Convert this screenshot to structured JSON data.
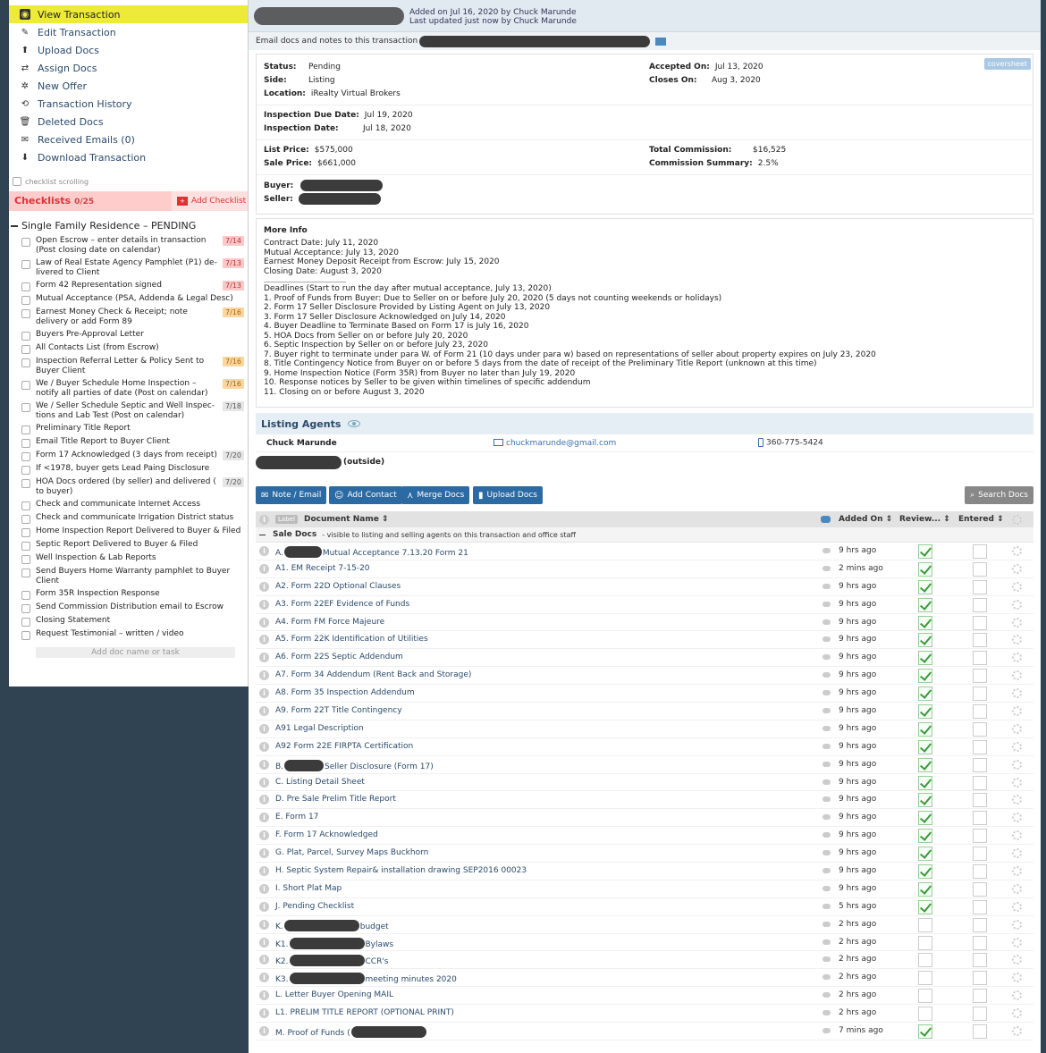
{
  "nav": [
    {
      "label": "View Transaction",
      "icon": "eye-icon",
      "glyph": "◉",
      "active": true
    },
    {
      "label": "Edit Transaction",
      "icon": "edit-icon",
      "glyph": "✎"
    },
    {
      "label": "Upload Docs",
      "icon": "upload-icon",
      "glyph": "⬆"
    },
    {
      "label": "Assign Docs",
      "icon": "assign-icon",
      "glyph": "⇄"
    },
    {
      "label": "New Offer",
      "icon": "gear-icon",
      "glyph": "✲"
    },
    {
      "label": "Transaction History",
      "icon": "history-icon",
      "glyph": "⟲"
    },
    {
      "label": "Deleted Docs",
      "icon": "trash-icon",
      "glyph": "🗑"
    },
    {
      "label": "Received Emails (0)",
      "icon": "mail-icon",
      "glyph": "✉"
    },
    {
      "label": "Download Transaction",
      "icon": "download-icon",
      "glyph": "⬇"
    }
  ],
  "checklist_scrolling": "checklist scrolling",
  "checklists": {
    "title": "Checklists",
    "count": "0/25",
    "add_label": "Add Checklist",
    "add_glyph": "+"
  },
  "checklist_group": "Single Family Residence – PENDING",
  "tasks": [
    {
      "text": "Open Escrow – enter details in transaction (Post closing date on calendar)",
      "due": "7/14",
      "c": "red"
    },
    {
      "text": "Law of Real Estate Agency Pamphlet (P1) de-livered to Client",
      "due": "7/13",
      "c": "red"
    },
    {
      "text": "Form 42 Representation signed",
      "due": "7/13",
      "c": "red"
    },
    {
      "text": "Mutual Acceptance (PSA, Addenda & Legal Desc)",
      "due": "",
      "c": ""
    },
    {
      "text": "Earnest Money Check & Receipt; note delivery or add Form 89",
      "due": "7/16",
      "c": "orange"
    },
    {
      "text": "Buyers Pre-Approval Letter",
      "due": "",
      "c": ""
    },
    {
      "text": "All Contacts List (from Escrow)",
      "due": "",
      "c": ""
    },
    {
      "text": "Inspection Referral Letter & Policy Sent to Buyer Client",
      "due": "7/16",
      "c": "orange"
    },
    {
      "text": "We / Buyer Schedule Home Inspection – notify all parties of date (Post on calendar)",
      "due": "7/16",
      "c": "orange"
    },
    {
      "text": "We / Seller Schedule Septic and Well Inspec-tions and Lab Test (Post on calendar)",
      "due": "7/18",
      "c": "gray"
    },
    {
      "text": "Preliminary Title Report",
      "due": "",
      "c": ""
    },
    {
      "text": "Email Title Report to Buyer Client",
      "due": "",
      "c": ""
    },
    {
      "text": "Form 17 Acknowledged (3 days from receipt)",
      "due": "7/20",
      "c": "gray"
    },
    {
      "text": "If <1978, buyer gets Lead Paing Disclosure",
      "due": "",
      "c": ""
    },
    {
      "text": "HOA Docs ordered (by seller) and delivered ( to buyer)",
      "due": "7/20",
      "c": "gray"
    },
    {
      "text": "Check and communicate Internet Access",
      "due": "",
      "c": ""
    },
    {
      "text": "Check and communicate Irrigation District status",
      "due": "",
      "c": ""
    },
    {
      "text": "Home Inspection Report Delivered to Buyer & Filed",
      "due": "",
      "c": ""
    },
    {
      "text": "Septic Report Delivered to Buyer & Filed",
      "due": "",
      "c": ""
    },
    {
      "text": "Well Inspection & Lab Reports",
      "due": "",
      "c": ""
    },
    {
      "text": "Send Buyers Home Warranty pamphlet to Buyer Client",
      "due": "",
      "c": ""
    },
    {
      "text": "Form 35R Inspection Response",
      "due": "",
      "c": ""
    },
    {
      "text": "Send Commission Distribution email to Escrow",
      "due": "",
      "c": ""
    },
    {
      "text": "Closing Statement",
      "due": "",
      "c": ""
    },
    {
      "text": "Request Testimonial – written / video",
      "due": "",
      "c": ""
    }
  ],
  "add_task_placeholder": "Add doc name or task",
  "header": {
    "added": "Added on Jul 16, 2020 by Chuck Marunde",
    "updated": "Last updated just now by Chuck Marunde"
  },
  "email_docs_label": "Email docs and notes to this transaction",
  "coversheet": "coversheet",
  "details": {
    "status_label": "Status:",
    "status": "Pending",
    "side_label": "Side:",
    "side": "Listing",
    "location_label": "Location:",
    "location": "iRealty Virtual Brokers",
    "accepted_label": "Accepted On:",
    "accepted": "Jul 13, 2020",
    "closes_label": "Closes On:",
    "closes": "Aug 3, 2020",
    "insp_due_label": "Inspection Due Date:",
    "insp_due": "Jul 19, 2020",
    "insp_date_label": "Inspection Date:",
    "insp_date": "Jul 18, 2020",
    "list_price_label": "List Price:",
    "list_price": "$575,000",
    "sale_price_label": "Sale Price:",
    "sale_price": "$661,000",
    "total_comm_label": "Total Commission:",
    "total_comm": "$16,525",
    "comm_summary_label": "Commission Summary:",
    "comm_summary": "2.5%",
    "buyer_label": "Buyer:",
    "seller_label": "Seller:"
  },
  "more_info": {
    "title": "More Info",
    "lines": [
      "Contract Date: July 11, 2020",
      "Mutual Acceptance: July 13, 2020",
      "Earnest Money Deposit Receipt from Escrow: July 15, 2020",
      "Closing Date: August 3, 2020"
    ],
    "deadlines": [
      "Deadlines (Start to run the day after mutual acceptance, July 13, 2020)",
      "1. Proof of Funds from Buyer: Due to Seller on or before July 20, 2020 (5 days not counting weekends or holidays)",
      "2. Form 17 Seller Disclosure Provided by Listing Agent on July 13, 2020",
      "3. Form 17 Seller Disclosure Acknowledged on July 14, 2020",
      "4. Buyer Deadline to Terminate Based on Form 17 is July 16, 2020",
      "5. HOA Docs from Seller on or before July 20, 2020",
      "6. Septic Inspection by Seller on or before July 23, 2020",
      "7. Buyer right to terminate under para W. of Form 21 (10 days under para w) based on representations of seller about property expires on July 23, 2020",
      "8. Title Contingency Notice from Buyer on or before 5 days from the date of receipt of the Preliminary Title Report (unknown at this time)",
      "9. Home Inspection Notice (Form 35R) from Buyer no later than July 19, 2020",
      "10. Response notices by Seller to be given within timelines of specific addendum",
      "11. Closing on or before August 3, 2020"
    ]
  },
  "listing_agents": {
    "title": "Listing Agents",
    "name": "Chuck Marunde",
    "email": "chuckmarunde@gmail.com",
    "phone": "360-775-5424",
    "outside": "(outside)"
  },
  "toolbar": {
    "note": "Note / Email",
    "add_contact": "Add Contact",
    "merge": "Merge Docs",
    "upload": "Upload Docs",
    "search": "Search Docs"
  },
  "table": {
    "label_badge": "Label",
    "doc_name": "Document Name",
    "added_on": "Added On",
    "reviewed": "Review...",
    "entered": "Entered"
  },
  "section": {
    "title": "Sale Docs",
    "desc": "- visible to listing and selling agents on this transaction and office staff"
  },
  "docs": [
    {
      "pre": "A.",
      "post": "Mutual Acceptance 7.13.20 Form 21",
      "r": 42,
      "added": "9 hrs ago",
      "rev": true
    },
    {
      "pre": "A1. EM Receipt 7-15-20",
      "post": "",
      "r": 0,
      "added": "2 mins ago",
      "rev": true
    },
    {
      "pre": "A2. Form 22D Optional Clauses",
      "post": "",
      "r": 0,
      "added": "9 hrs ago",
      "rev": true
    },
    {
      "pre": "A3. Form 22EF Evidence of Funds",
      "post": "",
      "r": 0,
      "added": "9 hrs ago",
      "rev": true
    },
    {
      "pre": "A4. Form FM Force Majeure",
      "post": "",
      "r": 0,
      "added": "9 hrs ago",
      "rev": true
    },
    {
      "pre": "A5. Form 22K Identification of Utilities",
      "post": "",
      "r": 0,
      "added": "9 hrs ago",
      "rev": true
    },
    {
      "pre": "A6. Form 22S Septic Addendum",
      "post": "",
      "r": 0,
      "added": "9 hrs ago",
      "rev": true
    },
    {
      "pre": "A7. Form 34 Addendum (Rent Back and Storage)",
      "post": "",
      "r": 0,
      "added": "9 hrs ago",
      "rev": true
    },
    {
      "pre": "A8. Form 35 Inspection Addendum",
      "post": "",
      "r": 0,
      "added": "9 hrs ago",
      "rev": true
    },
    {
      "pre": "A9. Form 22T Title Contingency",
      "post": "",
      "r": 0,
      "added": "9 hrs ago",
      "rev": true
    },
    {
      "pre": "A91 Legal Description",
      "post": "",
      "r": 0,
      "added": "9 hrs ago",
      "rev": true
    },
    {
      "pre": "A92 Form 22E FIRPTA Certification",
      "post": "",
      "r": 0,
      "added": "9 hrs ago",
      "rev": true
    },
    {
      "pre": "B.",
      "post": "Seller Disclosure (Form 17)",
      "r": 44,
      "added": "9 hrs ago",
      "rev": true
    },
    {
      "pre": "C. Listing Detail Sheet",
      "post": "",
      "r": 0,
      "added": "9 hrs ago",
      "rev": true
    },
    {
      "pre": "D. Pre Sale Prelim Title Report",
      "post": "",
      "r": 0,
      "added": "9 hrs ago",
      "rev": true
    },
    {
      "pre": "E. Form 17",
      "post": "",
      "r": 0,
      "added": "9 hrs ago",
      "rev": true
    },
    {
      "pre": "F. Form 17 Acknowledged",
      "post": "",
      "r": 0,
      "added": "9 hrs ago",
      "rev": true
    },
    {
      "pre": "G. Plat, Parcel, Survey Maps Buckhorn",
      "post": "",
      "r": 0,
      "added": "9 hrs ago",
      "rev": true
    },
    {
      "pre": "H. Septic System Repair& installation drawing SEP2016 00023",
      "post": "",
      "r": 0,
      "added": "9 hrs ago",
      "rev": true
    },
    {
      "pre": "I. Short Plat Map",
      "post": "",
      "r": 0,
      "added": "9 hrs ago",
      "rev": true
    },
    {
      "pre": "J. Pending Checklist",
      "post": "",
      "r": 0,
      "added": "5 hrs ago",
      "rev": true
    },
    {
      "pre": "K.",
      "post": "budget",
      "r": 84,
      "added": "2 hrs ago",
      "rev": false
    },
    {
      "pre": "K1.",
      "post": "Bylaws",
      "r": 84,
      "added": "2 hrs ago",
      "rev": false
    },
    {
      "pre": "K2.",
      "post": "CCR's",
      "r": 84,
      "added": "2 hrs ago",
      "rev": false
    },
    {
      "pre": "K3.",
      "post": "meeting minutes 2020",
      "r": 84,
      "added": "2 hrs ago",
      "rev": false
    },
    {
      "pre": "L. Letter Buyer Opening MAIL",
      "post": "",
      "r": 0,
      "added": "2 hrs ago",
      "rev": false
    },
    {
      "pre": "L1. PRELIM TITLE REPORT (OPTIONAL PRINT)",
      "post": "",
      "r": 0,
      "added": "2 hrs ago",
      "rev": false
    },
    {
      "pre": "M. Proof of Funds (",
      "post": "",
      "r": 84,
      "added": "7 mins ago",
      "rev": true
    }
  ]
}
